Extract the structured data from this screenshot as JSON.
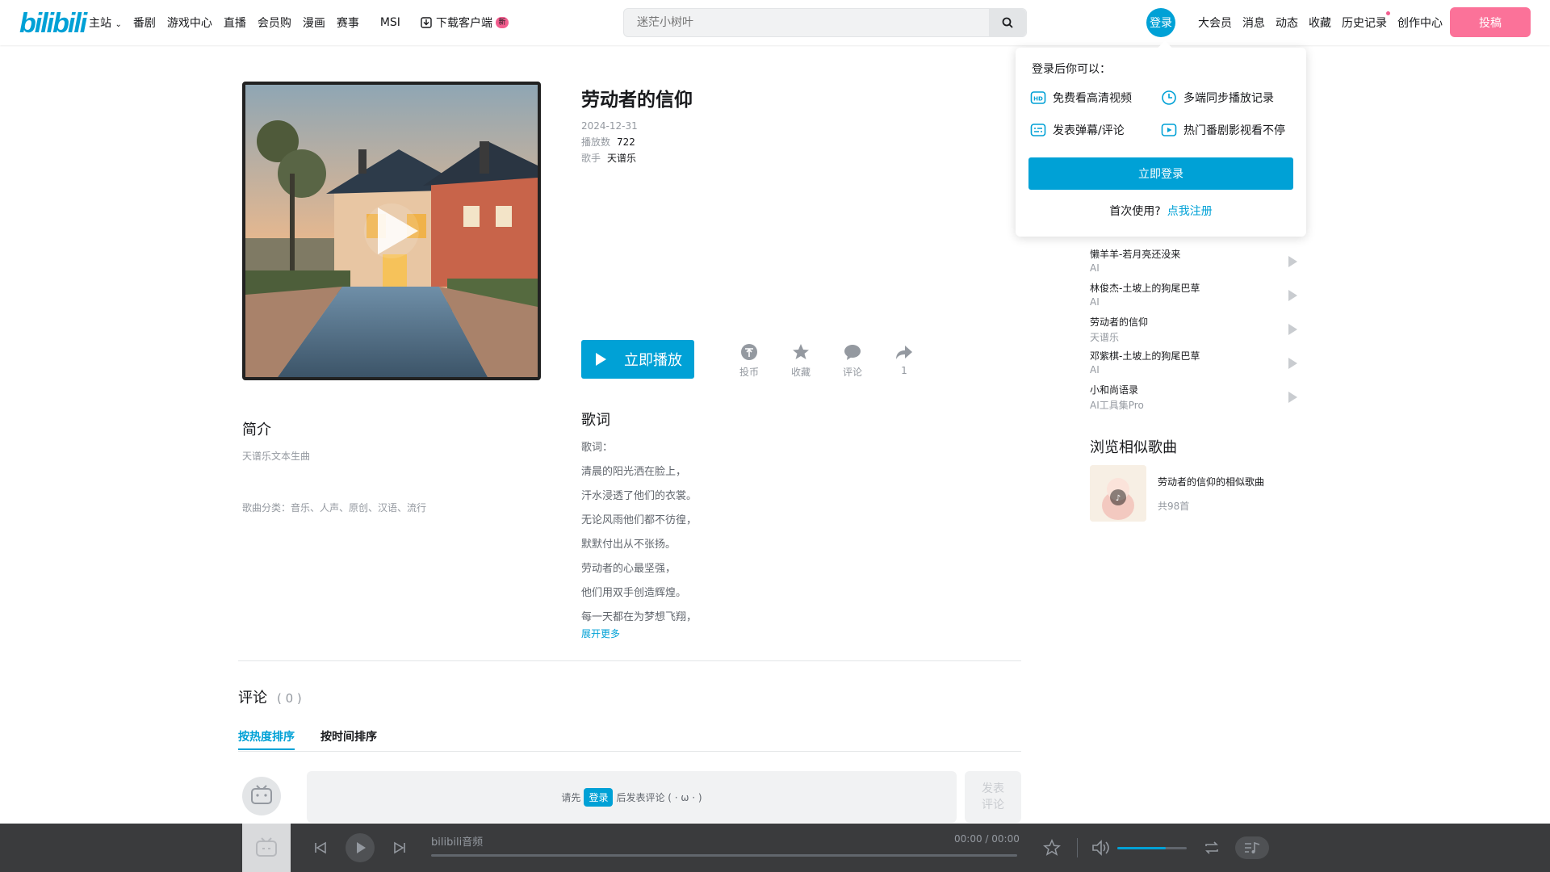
{
  "header": {
    "logo": "bilibili",
    "nav": [
      "主站",
      "番剧",
      "游戏中心",
      "直播",
      "会员购",
      "漫画",
      "赛事",
      "MSI"
    ],
    "download": "下载客户端",
    "download_badge": "新",
    "search_placeholder": "迷茫小树叶",
    "login_avatar": "登录",
    "right_nav": [
      "大会员",
      "消息",
      "动态",
      "收藏",
      "历史记录",
      "创作中心"
    ],
    "upload": "投稿"
  },
  "song": {
    "title": "劳动者的信仰",
    "date": "2024-12-31",
    "plays_label": "播放数",
    "plays": "722",
    "singer_label": "歌手",
    "singer": "天谱乐",
    "play_button": "立即播放",
    "actions": [
      {
        "icon": "coin-icon",
        "label": "投币"
      },
      {
        "icon": "star-icon",
        "label": "收藏"
      },
      {
        "icon": "comment-icon",
        "label": "评论"
      },
      {
        "icon": "share-icon",
        "label": "1"
      }
    ]
  },
  "intro": {
    "heading": "简介",
    "text": "天谱乐文本生曲",
    "categories": "歌曲分类：音乐、人声、原创、汉语、流行"
  },
  "lyrics": {
    "heading": "歌词",
    "lines": [
      "歌词：",
      "清晨的阳光洒在脸上，",
      "汗水浸透了他们的衣裳。",
      "无论风雨他们都不彷徨，",
      "默默付出从不张扬。",
      "劳动者的心最坚强，",
      "他们用双手创造辉煌。",
      "每一天都在为梦想飞翔，"
    ],
    "more": "展开更多"
  },
  "comments": {
    "title": "评论",
    "count": "( 0 )",
    "tab_hot": "按热度排序",
    "tab_time": "按时间排序",
    "prompt_before": "请先",
    "prompt_login": "登录",
    "prompt_after": "后发表评论 ( · ω · )",
    "send_line1": "发表",
    "send_line2": "评论"
  },
  "playlist": [
    {
      "name": "懒羊羊-若月亮还没来",
      "artist": "AI"
    },
    {
      "name": "林俊杰-土坡上的狗尾巴草",
      "artist": "AI"
    },
    {
      "name": "劳动者的信仰",
      "artist": "天谱乐"
    },
    {
      "name": "邓紫棋-土坡上的狗尾巴草",
      "artist": "AI"
    },
    {
      "name": "小和尚语录",
      "artist": "AI工具集Pro"
    }
  ],
  "similar": {
    "heading": "浏览相似歌曲",
    "name": "劳动者的信仰的相似歌曲",
    "count": "共98首"
  },
  "login_popup": {
    "title": "登录后你可以：",
    "features": [
      {
        "icon": "hd-icon",
        "label": "免费看高清视频"
      },
      {
        "icon": "clock-icon",
        "label": "多端同步播放记录"
      },
      {
        "icon": "danmaku-icon",
        "label": "发表弹幕/评论"
      },
      {
        "icon": "play-box-icon",
        "label": "热门番剧影视看不停"
      }
    ],
    "login_button": "立即登录",
    "first_time": "首次使用?",
    "register": "点我注册"
  },
  "player": {
    "name": "bilibili音频",
    "time": "00:00 / 00:00",
    "volume_fraction": 0.7
  },
  "colors": {
    "accent": "#00a1d6",
    "pink": "#fb7299",
    "player_bg": "#3a3b3d"
  }
}
